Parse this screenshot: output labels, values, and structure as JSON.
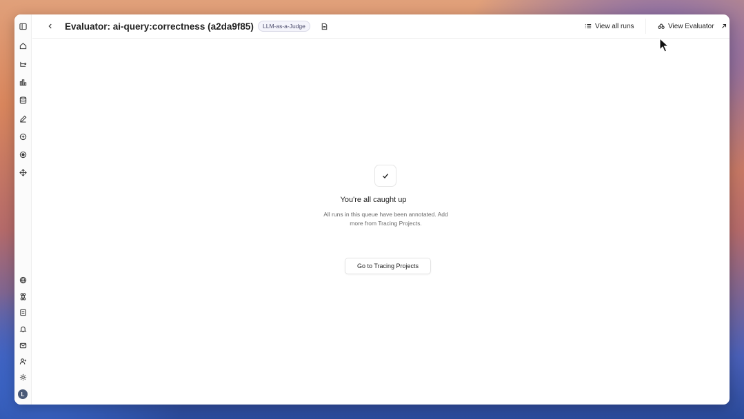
{
  "header": {
    "title": "Evaluator: ai-query:correctness (a2da9f85)",
    "badge": "LLM-as-a-Judge",
    "view_all_runs_label": "View all runs",
    "view_evaluator_label": "View Evaluator"
  },
  "empty_state": {
    "title": "You're all caught up",
    "description_line1": "All runs in this queue have been annotated. Add",
    "description_line2": "more from Tracing Projects.",
    "button_label": "Go to Tracing Projects"
  },
  "sidebar": {
    "top_icons": [
      "sidebar-toggle-icon",
      "home-icon",
      "tracing-icon",
      "chart-icon",
      "database-icon",
      "pencil-icon",
      "chat-icon",
      "play-circle-icon",
      "deploy-icon"
    ],
    "bottom_icons": [
      "globe-icon",
      "command-icon",
      "doc-icon",
      "bell-icon",
      "mail-icon",
      "user-plus-icon",
      "sun-icon"
    ],
    "avatar_initial": "L"
  }
}
